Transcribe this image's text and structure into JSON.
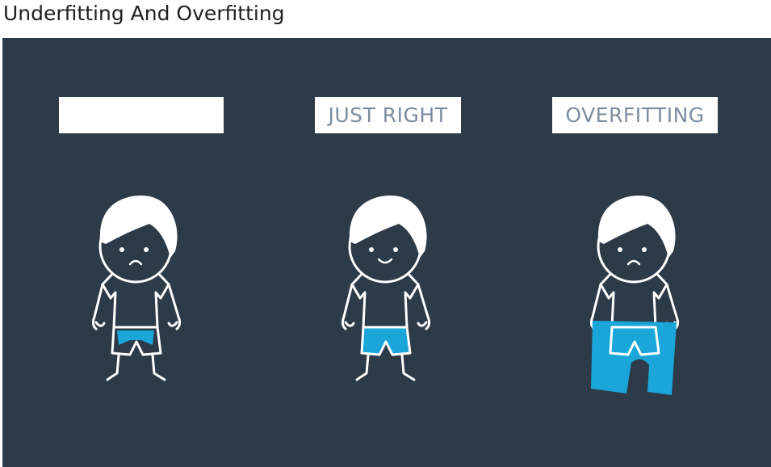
{
  "page": {
    "title": "Underfitting And Overfitting"
  },
  "slide": {
    "panels": [
      {
        "label": "",
        "mood": "sad",
        "shorts_fit": "too-small"
      },
      {
        "label": "JUST RIGHT",
        "mood": "happy",
        "shorts_fit": "just-right"
      },
      {
        "label": "OVERFITTING",
        "mood": "sad",
        "shorts_fit": "too-large"
      }
    ],
    "colors": {
      "background": "#2d3a48",
      "shorts": "#1aa6d9",
      "outline": "#ffffff",
      "label_text": "#7d8d9f"
    }
  }
}
